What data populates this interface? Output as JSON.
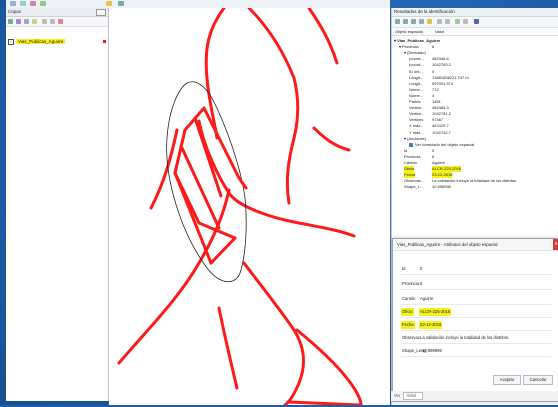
{
  "layers_panel": {
    "title": "Capas",
    "layer_name": "Vias_Publicas_Aguirre"
  },
  "identify": {
    "title": "Resultados de la identificación",
    "col_feature": "Objeto espacial",
    "col_value": "Valor",
    "rows": [
      {
        "k": "▾ Vias_Publicas_Aguirre",
        "v": "",
        "indent": 0,
        "bold": true
      },
      {
        "k": "▾ Provincia",
        "v": "6",
        "indent": 1
      },
      {
        "k": "▾ (Derivado)",
        "v": "",
        "indent": 2
      },
      {
        "k": "(coord...",
        "v": "482446.6",
        "indent": 3
      },
      {
        "k": "(coord...",
        "v": "1042763.2",
        "indent": 3
      },
      {
        "k": "ID del...",
        "v": "0",
        "indent": 3
      },
      {
        "k": "Longit...",
        "v": "13681656221,747 m",
        "indent": 3
      },
      {
        "k": "Longit...",
        "v": "997001,574",
        "indent": 3
      },
      {
        "k": "Núme...",
        "v": "772",
        "indent": 3
      },
      {
        "k": "Núme...",
        "v": "4",
        "indent": 3
      },
      {
        "k": "Partes",
        "v": "1451",
        "indent": 3
      },
      {
        "k": "Vertice...",
        "v": "482484.3",
        "indent": 3
      },
      {
        "k": "Vertice...",
        "v": "1042781.2",
        "indent": 3
      },
      {
        "k": "Vertices",
        "v": "97467",
        "indent": 3
      },
      {
        "k": "X máx...",
        "v": "482429.7",
        "indent": 3
      },
      {
        "k": "Y máx...",
        "v": "1042742.7",
        "indent": 3
      },
      {
        "k": "▾ (Acciones)",
        "v": "",
        "indent": 2
      },
      {
        "k": "",
        "v": "Ver formulario del objeto espacial",
        "indent": 3,
        "icon": true
      },
      {
        "k": "Id",
        "v": "0",
        "indent": 2
      },
      {
        "k": "Provincia",
        "v": "6",
        "indent": 2
      },
      {
        "k": "Cantón",
        "v": "Aguirre",
        "indent": 2
      },
      {
        "k": "Oficio",
        "v": "ALCR-225-2016",
        "indent": 2,
        "hl": true
      },
      {
        "k": "Fecha",
        "v": "23-12-2016",
        "indent": 2,
        "hl": true
      },
      {
        "k": "Observac...",
        "v": "La validación incluye la totalidad de los distritos.",
        "indent": 2
      },
      {
        "k": "Shape_L...",
        "v": "10,998996",
        "indent": 2
      }
    ]
  },
  "dialog": {
    "title": "Vias_Publicas_Aguirre - Atributos del objeto espacial",
    "close": "x",
    "fields": [
      {
        "label": "Id",
        "value": "0"
      },
      {
        "label": "Provincia",
        "value": "6"
      },
      {
        "label": "Cantón",
        "value": "Aguirre"
      },
      {
        "label": "Oficio",
        "value": "ALCR-225-2016",
        "hl": true
      },
      {
        "label": "Fecha",
        "value": "23-12-2016",
        "hl": true
      },
      {
        "label": "Observac",
        "value": "La validación incluye la totalidad de los distritos."
      },
      {
        "label": "Shape_Leng",
        "value": "10,998996"
      }
    ],
    "accept": "Aceptar",
    "cancel": "Cancelar"
  },
  "status": {
    "label": "Ver",
    "value": "Árbol"
  },
  "colors": {
    "road": "#ff1a1a",
    "highlight": "#f4f21a",
    "boundary": "#222222"
  }
}
